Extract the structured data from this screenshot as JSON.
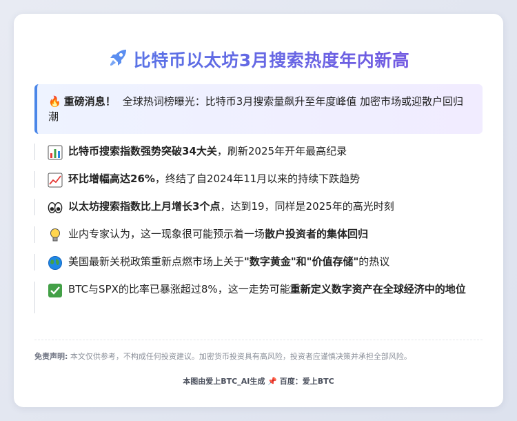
{
  "title": "比特币以太坊3月搜索热度年内新高",
  "callout": {
    "lead": "重磅消息！",
    "text": "全球热词榜曝光：比特币3月搜索量飙升至年度峰值 加密市场或迎散户回归潮"
  },
  "items": [
    {
      "icon": "bar-chart-icon",
      "bold": "比特币搜索指数强势突破34大关",
      "rest": "，刷新2025年开年最高纪录"
    },
    {
      "icon": "chart-increasing-icon",
      "bold": "环比增幅高达26%",
      "rest": "，终结了自2024年11月以来的持续下跌趋势"
    },
    {
      "icon": "eyes-icon",
      "bold": "以太坊搜索指数比上月增长3个点",
      "rest": "，达到19，同样是2025年的高光时刻"
    },
    {
      "icon": "light-bulb-icon",
      "pre": "业内专家认为，这一现象很可能预示着一场",
      "bold": "散户投资者的集体回归"
    },
    {
      "icon": "globe-icon",
      "pre": "美国最新关税政策重新点燃市场上关于",
      "bold": "\"数字黄金\"和\"价值存储\"",
      "rest": "的热议"
    },
    {
      "icon": "check-mark-icon",
      "pre": "BTC与SPX的比率已暴涨超过8%，这一走势可能",
      "bold": "重新定义数字资产在全球经济中的地位"
    }
  ],
  "disclaimer": {
    "label": "免责声明:",
    "text": "本文仅供参考，不构成任何投资建议。加密货币投资具有高风险，投资者应谨慎决策并承担全部风险。"
  },
  "footer": {
    "left": "本图由爱上BTC_AI生成",
    "right": "百度：爱上BTC"
  },
  "colors": {
    "accent_blue": "#4a86e8",
    "accent_purple": "#7b52e0"
  }
}
